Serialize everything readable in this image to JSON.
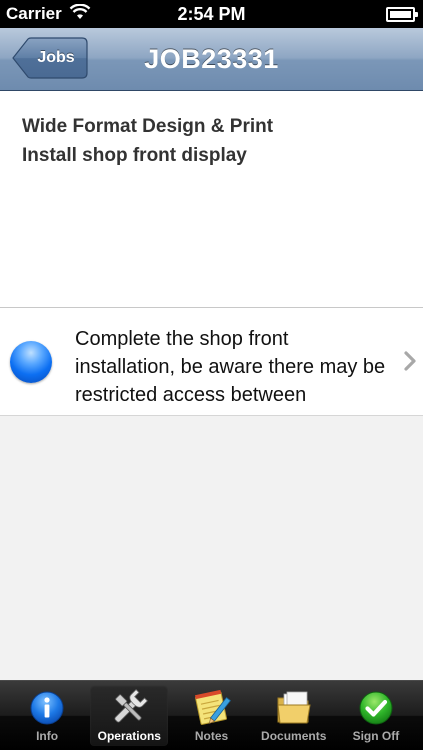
{
  "status_bar": {
    "carrier": "Carrier",
    "time": "2:54 PM"
  },
  "nav": {
    "back_label": "Jobs",
    "title": "JOB23331"
  },
  "job": {
    "line1": "Wide Format Design & Print",
    "line2": "Install shop front display"
  },
  "operation": {
    "text": "Complete the shop front installation, be aware there may be restricted access between",
    "status_color": "#0c6ff2"
  },
  "tabs": [
    {
      "label": "Info",
      "icon": "info-icon"
    },
    {
      "label": "Operations",
      "icon": "wrench-icon"
    },
    {
      "label": "Notes",
      "icon": "notepad-icon"
    },
    {
      "label": "Documents",
      "icon": "folder-icon"
    },
    {
      "label": "Sign Off",
      "icon": "checkmark-icon"
    }
  ],
  "active_tab": "Operations"
}
